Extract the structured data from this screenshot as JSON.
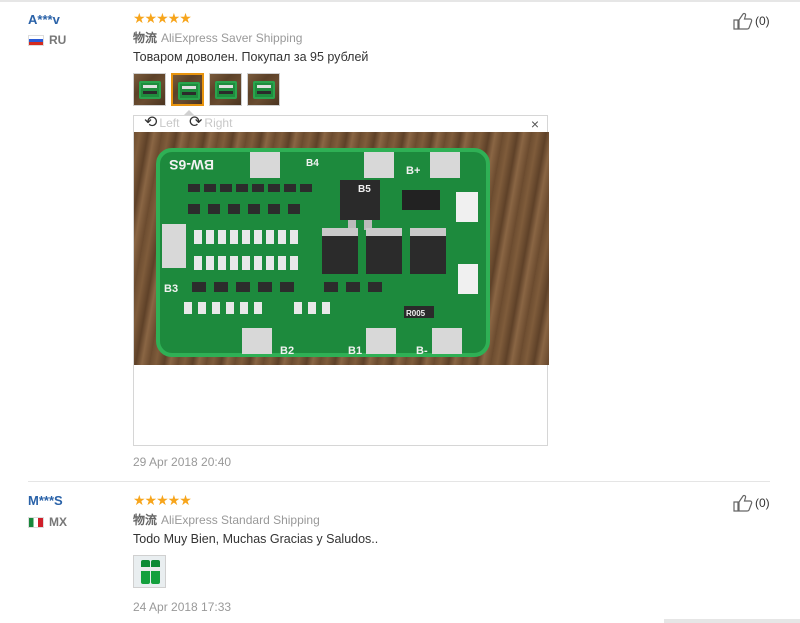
{
  "reviews": [
    {
      "user": "A***v",
      "country": "RU",
      "stars": "★★★★★",
      "shipping_label": "物流",
      "shipping_method": "AliExpress Saver Shipping",
      "comment": "Товаром доволен. Покупал за 95 рублей",
      "viewer": {
        "left_label": "Left",
        "right_label": "Right",
        "close": "×"
      },
      "date": "29 Apr 2018 20:40",
      "helpful": "(0)"
    },
    {
      "user": "M***S",
      "country": "MX",
      "stars": "★★★★★",
      "shipping_label": "物流",
      "shipping_method": "AliExpress Standard Shipping",
      "comment": "Todo Muy Bien, Muchas Gracias y Saludos..",
      "date": "24 Apr 2018 17:33",
      "helpful": "(0)"
    }
  ],
  "pcb_labels": {
    "model": "BW-6S",
    "b4": "B4",
    "b5": "B5",
    "b_plus": "B+",
    "b3": "B3",
    "b2": "B2",
    "b1": "B1",
    "b_minus": "B-",
    "r005": "R005"
  },
  "icons": {
    "thumbs_up": "thumbs-up-icon",
    "rotate_left": "rotate-left-icon",
    "rotate_right": "rotate-right-icon",
    "close": "close-icon"
  },
  "colors": {
    "username": "#2a62a8",
    "stars": "#f7a51c",
    "active_thumb": "#e8940e",
    "pcb": "#1f8c3e"
  }
}
